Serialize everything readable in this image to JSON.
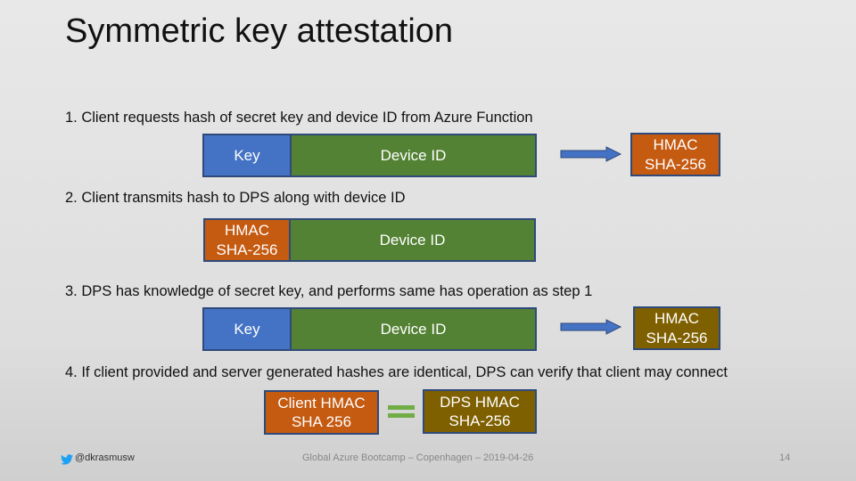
{
  "slide": {
    "title": "Symmetric key attestation",
    "steps": [
      {
        "text": "1. Client requests hash of secret key and device ID from Azure Function"
      },
      {
        "text": "2. Client transmits hash to DPS along with device ID"
      },
      {
        "text": "3. DPS has knowledge of secret key, and performs same has operation as step 1"
      },
      {
        "text": "4. If client provided and server generated hashes are identical, DPS can verify that client may connect"
      }
    ],
    "row1": {
      "key": "Key",
      "device_id": "Device ID",
      "hmac_line1": "HMAC",
      "hmac_line2": "SHA-256"
    },
    "row2": {
      "hmac_line1": "HMAC",
      "hmac_line2": "SHA-256",
      "device_id": "Device ID"
    },
    "row3": {
      "key": "Key",
      "device_id": "Device ID",
      "hmac_line1": "HMAC",
      "hmac_line2": "SHA-256"
    },
    "row4": {
      "client_line1": "Client HMAC",
      "client_line2": "SHA 256",
      "dps_line1": "DPS HMAC",
      "dps_line2": "SHA-256"
    },
    "colors": {
      "key": "#4472c4",
      "device_id": "#548235",
      "client_hash": "#c55a11",
      "server_hash": "#7f6000",
      "equals": "#70ad47"
    }
  },
  "footer": {
    "handle": "@dkrasmusw",
    "event": "Global Azure Bootcamp – Copenhagen – 2019-04-26",
    "page_number": "14"
  }
}
